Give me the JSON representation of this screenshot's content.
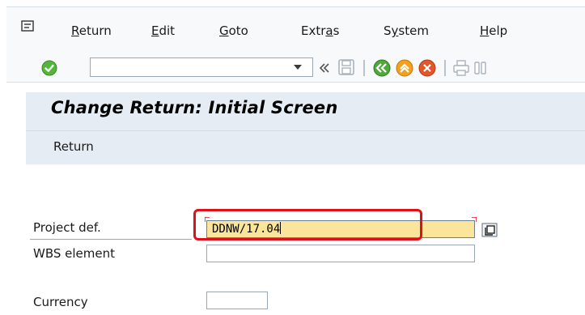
{
  "menu": {
    "items": [
      {
        "pre": "",
        "u": "R",
        "post": "eturn"
      },
      {
        "pre": "",
        "u": "E",
        "post": "dit"
      },
      {
        "pre": "",
        "u": "G",
        "post": "oto"
      },
      {
        "pre": "Extr",
        "u": "a",
        "post": "s"
      },
      {
        "pre": "S",
        "u": "y",
        "post": "stem"
      },
      {
        "pre": "",
        "u": "H",
        "post": "elp"
      }
    ]
  },
  "toolbar": {
    "command_field_value": "",
    "icons": [
      "ok-icon",
      "dropdown-icon",
      "double-chevron-left-icon",
      "save-icon",
      "back-icon",
      "exit-icon",
      "cancel-icon",
      "print-icon",
      "find-icon"
    ]
  },
  "screen": {
    "title": "Change Return: Initial Screen",
    "appbar_button": "Return"
  },
  "form": {
    "project_def_label": "Project def.",
    "project_def_value": "DDNW/17.04",
    "wbs_label": "WBS element",
    "wbs_value": "",
    "currency_label": "Currency",
    "currency_value": ""
  },
  "colors": {
    "highlight": "#e0101b",
    "active_field": "#fbe59b",
    "header_bg": "#e6ecf3"
  }
}
